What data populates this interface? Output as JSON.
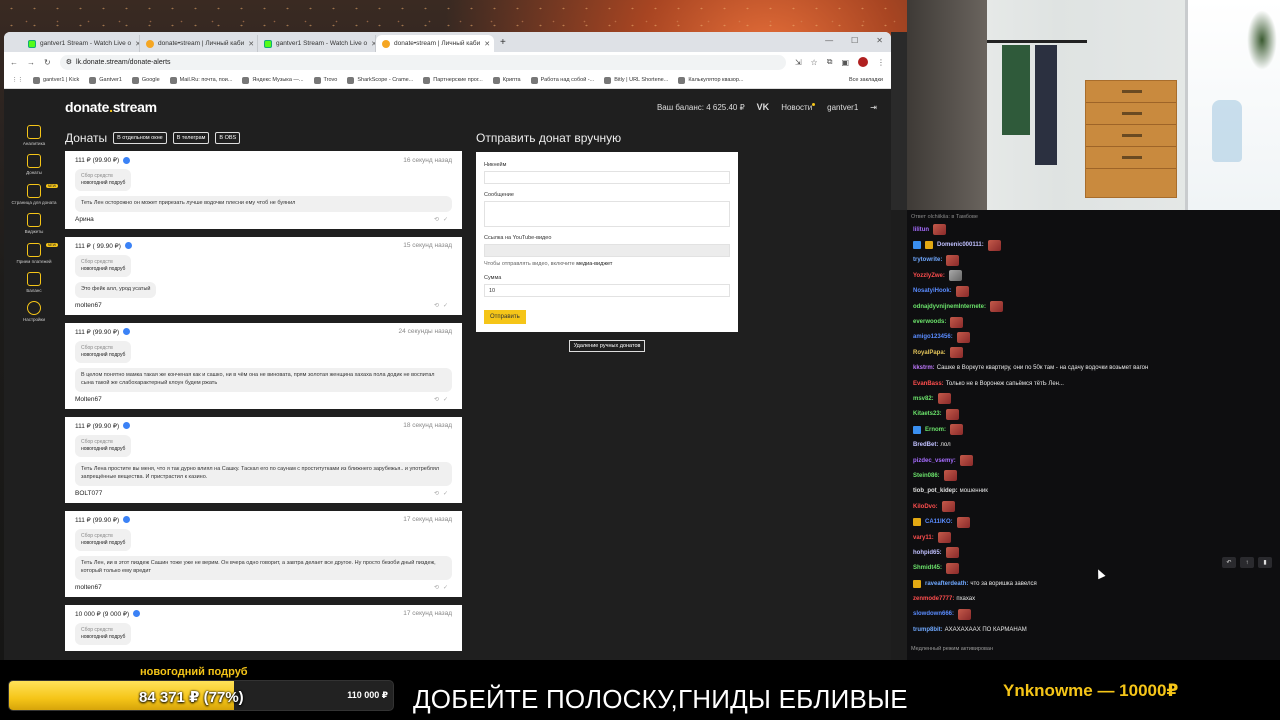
{
  "browser": {
    "tabs": [
      {
        "label": "gantver1 Stream - Watch Live o",
        "fav": "green",
        "active": false
      },
      {
        "label": "donate•stream | Личный каби",
        "fav": "orange",
        "active": false
      },
      {
        "label": "gantver1 Stream - Watch Live o",
        "fav": "green",
        "active": false
      },
      {
        "label": "donate•stream | Личный каби",
        "fav": "orange",
        "active": true
      }
    ],
    "url": "lk.donate.stream/donate-alerts",
    "bookmarks": [
      "gantver1 | Kick",
      "Gantver1",
      "Google",
      "Mail.Ru: почта, пои...",
      "Яндекс Музыка —...",
      "Trovo",
      "SharkScope - Crame...",
      "Партнерские прог...",
      "Крипта",
      "Работа над собой -...",
      "Bitly | URL Shortene...",
      "Калькулятор квазор..."
    ],
    "all_bookmarks": "Все закладки"
  },
  "site": {
    "logo_pre": "donate",
    "logo_dot": ".",
    "logo_post": "stream",
    "balance": "Ваш баланс: 4 625.40 ₽",
    "vk": "VK",
    "news": "Новости",
    "user": "gantver1",
    "sidebar": [
      "Аналитика",
      "Донаты",
      "Страница для доната",
      "Виджеты",
      "Прием платежей",
      "Баланс",
      "Настройки"
    ],
    "new_badge": "NEW",
    "donations_title": "Донаты",
    "btn_window": "В отдельном окне",
    "btn_telegram": "В телеграм",
    "btn_obs": "В OBS",
    "goal_label": "Сбор средств",
    "goal_name": "новогодний подруб",
    "donations": [
      {
        "amount": "111 ₽ (99.90 ₽)",
        "time": "16 секунд назад",
        "message": "Теть Лен осторожно он может прирезать лучше водочки плесни ему чтоб не буянил",
        "name": "Арина"
      },
      {
        "amount": "111 ₽ ( 99.90 ₽)",
        "time": "15 секунд назад",
        "message": "Это фейк алл, урод усатый",
        "name": "molten67"
      },
      {
        "amount": "111 ₽ (99.90 ₽)",
        "time": "24 секунды назад",
        "message": "В целом понятно мамка такая же конченая как и сашко, ни в чём она не виновата, прям золотая женщина хахаха пола додик не воспитал сына такой же слабохарактерный клоун будем ржать",
        "name": "Molten67"
      },
      {
        "amount": "111 ₽ (99.90 ₽)",
        "time": "18 секунд назад",
        "message": "Теть Лена простите вы меня, что я так дурно влиял на Сашку. Таскал его по саунам с проститутками из ближнего зарубежья.. и употреблял запрещённые вещества. И пристрастил к казино.",
        "name": "BOLT077"
      },
      {
        "amount": "111 ₽ (99.90 ₽)",
        "time": "17 секунд назад",
        "message": "Теть Лен, ии в этот пиздеж Сашин тоже уже не верим. Он вчера одно говорит, а завтра делает все другое. Ну просто безоби дный пиздеж, который только ему вредит",
        "name": "molten67"
      },
      {
        "amount": "10 000 ₽ (9 000 ₽)",
        "time": "17 секунд назад",
        "message": "",
        "name": ""
      }
    ],
    "manual_title": "Отправить донат вручную",
    "f_nick": "Никнейм",
    "f_msg": "Сообщение",
    "f_yt": "Ссылка на YouTube-видео",
    "f_yt_note_pre": "Чтобы отправлять видео, включите",
    "f_yt_note_link": "медиа-виджет",
    "f_sum": "Сумма",
    "f_sum_value": "10",
    "send_btn": "Отправить",
    "delete_btn": "Удаление ручных донатов"
  },
  "chat": {
    "reply": "Ответ olchiikiia: в Тамбове",
    "messages": [
      {
        "user": "lilitun",
        "color": "#a66cff",
        "text": "",
        "emote": true,
        "badges": []
      },
      {
        "user": "Domenic000111:",
        "color": "#c0c0ff",
        "text": "",
        "emote": true,
        "badges": [
          "blue",
          "gold"
        ]
      },
      {
        "user": "trytowrite:",
        "color": "#6fa8ff",
        "text": "",
        "emote": true,
        "badges": []
      },
      {
        "user": "YozzlyZwe:",
        "color": "#ff4e4e",
        "text": "",
        "emote": true,
        "badges": []
      },
      {
        "user": "NosatyiHook:",
        "color": "#5a8cff",
        "text": "",
        "emote": true,
        "badges": []
      },
      {
        "user": "odnajdyvnijnemInternete:",
        "color": "#6be36b",
        "text": "",
        "emote": true,
        "badges": []
      },
      {
        "user": "everwoods:",
        "color": "#6be36b",
        "text": "",
        "emote": true,
        "badges": []
      },
      {
        "user": "amigo123456:",
        "color": "#5a8cff",
        "text": "",
        "emote": true,
        "badges": []
      },
      {
        "user": "RoyalPapa:",
        "color": "#e3c45a",
        "text": "",
        "emote": true,
        "badges": []
      },
      {
        "user": "kkstrm:",
        "color": "#c07aff",
        "text": "Сашке в Воркуте квартиру, они по 50к там - на сдачу водочки возьмет вагон",
        "emote": false,
        "badges": []
      },
      {
        "user": "EvanBass:",
        "color": "#ff4e4e",
        "text": "Только не в Воронеж сапьёмся тётЬ Лен...",
        "emote": false,
        "badges": []
      },
      {
        "user": "msv82:",
        "color": "#6be36b",
        "text": "",
        "emote": true,
        "badges": []
      },
      {
        "user": "Kitaets23:",
        "color": "#6be36b",
        "text": "",
        "emote": true,
        "badges": []
      },
      {
        "user": "Ernom:",
        "color": "#6be36b",
        "text": "",
        "emote": true,
        "badges": [
          "blue"
        ]
      },
      {
        "user": "BredBet:",
        "color": "#c0c0ff",
        "text": "лол",
        "emote": false,
        "badges": []
      },
      {
        "user": "pizdec_vsemy:",
        "color": "#a66cff",
        "text": "",
        "emote": true,
        "badges": []
      },
      {
        "user": "Stein086:",
        "color": "#6be36b",
        "text": "",
        "emote": true,
        "badges": []
      },
      {
        "user": "tiob_pot_kidep:",
        "color": "#e0e0e0",
        "text": "мошенник",
        "emote": false,
        "badges": []
      },
      {
        "user": "KiloDvo:",
        "color": "#ff4e4e",
        "text": "",
        "emote": true,
        "badges": []
      },
      {
        "user": "CA11IKO:",
        "color": "#5a8cff",
        "text": "",
        "emote": true,
        "badges": [
          "gold"
        ]
      },
      {
        "user": "vary11:",
        "color": "#ff4e4e",
        "text": "",
        "emote": true,
        "badges": []
      },
      {
        "user": "hohpid65:",
        "color": "#c0c0ff",
        "text": "",
        "emote": true,
        "badges": []
      },
      {
        "user": "Shmidt45:",
        "color": "#6be36b",
        "text": "",
        "emote": true,
        "badges": []
      },
      {
        "user": "raveafterdeath:",
        "color": "#6fa8ff",
        "text": "что за воришка завелся",
        "emote": false,
        "badges": [
          "gold"
        ]
      },
      {
        "user": "zenmode7777:",
        "color": "#ff4e4e",
        "text": "пхахах",
        "emote": false,
        "badges": []
      },
      {
        "user": "slowdown666:",
        "color": "#5a8cff",
        "text": "",
        "emote": true,
        "badges": []
      },
      {
        "user": "trump8bit:",
        "color": "#6fa8ff",
        "text": "АХАХАХААХ ПО КАРМАНАМ",
        "emote": false,
        "badges": []
      }
    ],
    "status": "Медленный режим активирован"
  },
  "overlay": {
    "goal_title": "новогодний подруб",
    "goal_current": "84 371 ₽ (77%)",
    "goal_target": "110 000 ₽",
    "goal_progress": 0.77,
    "ticker": "ДОБЕЙТЕ ПОЛОСКУ,ГНИДЫ ЕБЛИВЫЕ",
    "top_donor": "Ynknowme — 10000₽"
  }
}
